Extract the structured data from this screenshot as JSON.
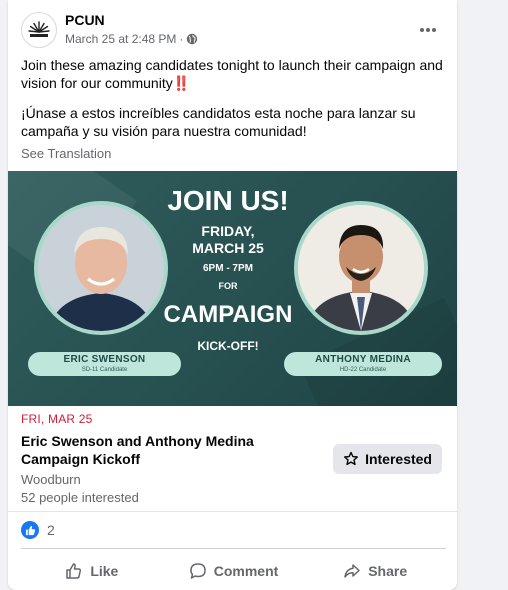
{
  "post": {
    "page_name": "PCUN",
    "timestamp": "March 25 at 2:48 PM",
    "separator": "·",
    "text_en": "Join these amazing candidates tonight to launch their campaign and vision for our community",
    "text_en_emoji": "‼️",
    "text_es": "¡Únase a estos increíbles candidatos esta noche para lanzar su campaña y su visión para nuestra comunidad!",
    "see_translation": "See Translation"
  },
  "image": {
    "headline": "JOIN US!",
    "day": "FRIDAY,",
    "date": "MARCH 25",
    "time": "6PM - 7PM",
    "for": "FOR",
    "campaign": "CAMPAIGN",
    "kickoff": "KICK-OFF!",
    "left_name": "ERIC SWENSON",
    "left_role": "SD-11 Candidate",
    "right_name": "ANTHONY MEDINA",
    "right_role": "HD-22 Candidate"
  },
  "event": {
    "date": "FRI, MAR 25",
    "title": "Eric Swenson and Anthony Medina Campaign Kickoff",
    "location": "Woodburn",
    "interested_count": "52 people interested",
    "interested_button": "Interested"
  },
  "reactions": {
    "count": "2"
  },
  "actions": {
    "like": "Like",
    "comment": "Comment",
    "share": "Share"
  },
  "colors": {
    "facebook_blue": "#1877f2",
    "event_date_red": "#d21c38",
    "image_teal": "#2f5d5c",
    "pill_mint": "#bfe6da"
  },
  "icons": {
    "avatar": "pcun-logo-icon",
    "privacy": "globe-icon",
    "more": "more-horizontal-icon",
    "interested": "star-icon",
    "reaction": "thumbs-up-icon",
    "like": "thumbs-up-outline-icon",
    "comment": "comment-icon",
    "share": "share-icon"
  }
}
